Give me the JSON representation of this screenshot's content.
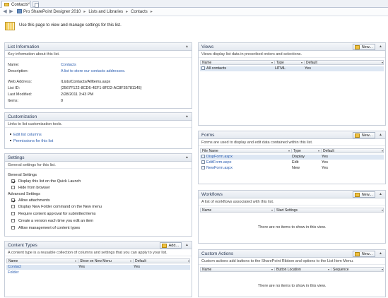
{
  "tab": {
    "label": "Contacts",
    "close": "×"
  },
  "nav": {
    "back": "◀",
    "forward": "▶"
  },
  "breadcrumb": [
    "Pro SharePoint Designer 2010",
    "Lists and Libraries",
    "Contacts"
  ],
  "breadcrumb_sep": "▸",
  "intro": "Use this page to view and manage settings for this list.",
  "list_info": {
    "title": "List Information",
    "desc": "Key information about this list.",
    "name_label": "Name:",
    "name_value": "Contacts",
    "description_label": "Description:",
    "description_value": "A list to store our contacts addresses.",
    "web_label": "Web Address:",
    "web_value": "/Lists/Contacts/AllItems.aspx",
    "listid_label": "List ID:",
    "listid_value": "{2567F122-8CD6-4EF1-8FD2-AC8F35781145}",
    "modified_label": "Last Modified:",
    "modified_value": "2/28/2011 3:43 PM",
    "items_label": "Items:",
    "items_value": "0"
  },
  "customization": {
    "title": "Customization",
    "desc": "Links to list customization tools.",
    "links": [
      "Edit list columns",
      "Permissions for this list"
    ]
  },
  "settings": {
    "title": "Settings",
    "desc": "General settings for this list.",
    "general_label": "General Settings",
    "general": [
      {
        "label": "Display this list on the Quick Launch",
        "checked": true
      },
      {
        "label": "Hide from browser",
        "checked": false
      }
    ],
    "advanced_label": "Advanced Settings",
    "advanced": [
      {
        "label": "Allow attachments",
        "checked": true
      },
      {
        "label": "Display New Folder command on the New menu",
        "checked": false
      },
      {
        "label": "Require content approval for submitted items",
        "checked": false
      },
      {
        "label": "Create a version each time you edit an item",
        "checked": false
      },
      {
        "label": "Allow management of content types",
        "checked": false
      }
    ]
  },
  "content_types": {
    "title": "Content Types",
    "button": "Add...",
    "desc": "A content type is a reusable collection of columns and settings that you can apply to your list.",
    "columns": [
      "Name",
      "Show on New Menu",
      "Default"
    ],
    "rows": [
      {
        "name": "Contact",
        "show": "Yes",
        "default": "Yes"
      },
      {
        "name": "Folder",
        "show": "",
        "default": ""
      }
    ]
  },
  "views": {
    "title": "Views",
    "button": "New...",
    "desc": "Views display list data in prescribed orders and selections.",
    "columns": [
      "Name",
      "Type",
      "Default"
    ],
    "rows": [
      {
        "name": "All contacts",
        "type": "HTML",
        "default": "Yes"
      }
    ]
  },
  "forms": {
    "title": "Forms",
    "button": "New...",
    "desc": "Forms are used to display and edit data contained within this list.",
    "columns": [
      "File Name",
      "Type",
      "Default"
    ],
    "rows": [
      {
        "name": "DispForm.aspx",
        "type": "Display",
        "default": "Yes"
      },
      {
        "name": "EditForm.aspx",
        "type": "Edit",
        "default": "Yes"
      },
      {
        "name": "NewForm.aspx",
        "type": "New",
        "default": "Yes"
      }
    ]
  },
  "workflows": {
    "title": "Workflows",
    "button": "New...",
    "desc": "A list of workflows associated with this list.",
    "columns": [
      "Name",
      "Start Settings"
    ],
    "empty": "There are no items to show in this view."
  },
  "custom_actions": {
    "title": "Custom Actions",
    "button": "New...",
    "desc": "Custom actions add buttons to the SharePoint Ribbon and options to the List Item Menu.",
    "columns": [
      "Name",
      "Button Location",
      "Sequence"
    ],
    "empty": "There are no items to show in this view."
  },
  "collapse_glyph": "▲",
  "dropdown_glyph": "▾"
}
